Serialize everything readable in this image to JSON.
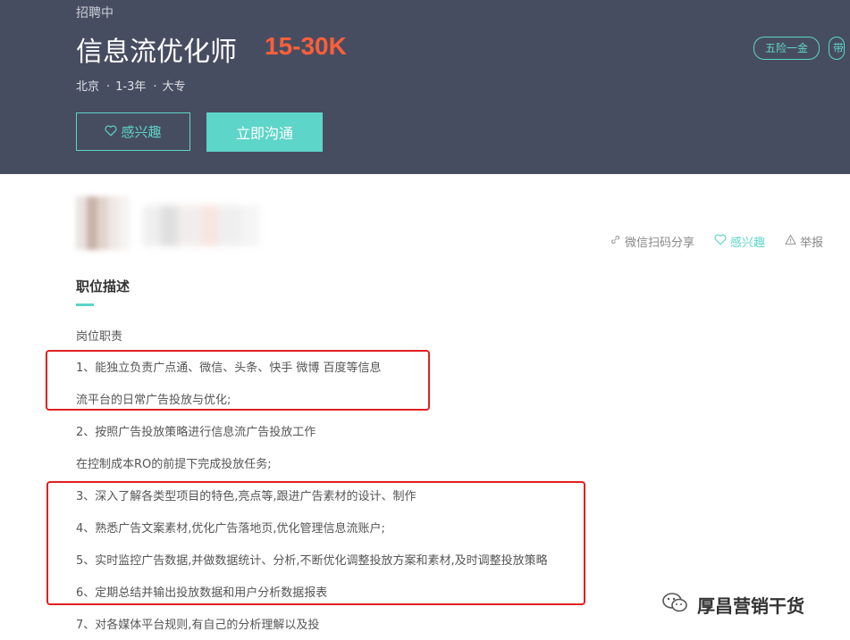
{
  "header": {
    "status": "招聘中",
    "title": "信息流优化师",
    "salary": "15-30K",
    "location": "北京",
    "experience": "1-3年",
    "education": "大专",
    "interest_button": "感兴趣",
    "chat_button": "立即沟通",
    "tags": [
      "五险一金",
      "带"
    ]
  },
  "actions": {
    "share": "微信扫码分享",
    "interest": "感兴趣",
    "report": "举报"
  },
  "section": {
    "title": "职位描述",
    "lines": [
      "岗位职责",
      "1、能独立负责广点通、微信、头条、快手 微博 百度等信息",
      "流平台的日常广告投放与优化;",
      "2、按照广告投放策略进行信息流广告投放工作",
      "在控制成本RO的前提下完成投放任务;",
      "3、深入了解各类型项目的特色,亮点等,跟进广告素材的设计、制作",
      "4、熟悉广告文案素材,优化广告落地页,优化管理信息流账户;",
      "5、实时监控广告数据,并做数据统计、分析,不断优化调整投放方案和素材,及时调整投放策略",
      "6、定期总结并输出投放数据和用户分析数据报表",
      "7、对各媒体平台规则,有自己的分析理解以及投"
    ]
  },
  "watermark": {
    "text": "厚昌营销干货"
  },
  "colors": {
    "header_bg": "#474d61",
    "accent": "#5dd5c8",
    "salary": "#fd5f39",
    "highlight_box": "#e02020"
  }
}
